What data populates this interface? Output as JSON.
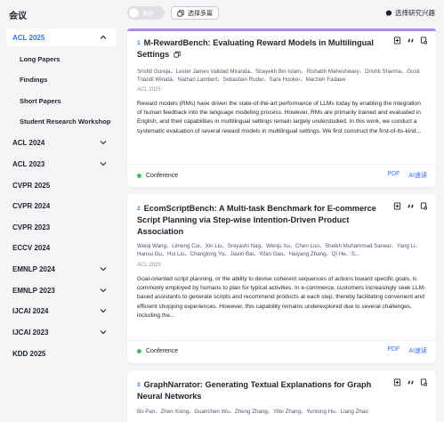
{
  "sidebar": {
    "title": "会议",
    "items": [
      {
        "label": "ACL 2025",
        "expanded": true
      },
      {
        "label": "ACL 2024"
      },
      {
        "label": "ACL 2023"
      },
      {
        "label": "CVPR 2025"
      },
      {
        "label": "CVPR 2024"
      },
      {
        "label": "CVPR 2023"
      },
      {
        "label": "ECCV 2024"
      },
      {
        "label": "EMNLP 2024"
      },
      {
        "label": "EMNLP 2023"
      },
      {
        "label": "IJCAI 2024"
      },
      {
        "label": "IJCAI 2023"
      },
      {
        "label": "KDD 2025"
      }
    ],
    "subitems": [
      "Long Papers",
      "Findings",
      "Short Papers",
      "Student Research Workshop"
    ]
  },
  "toolbar": {
    "toggle_label": "速读",
    "multi_select_label": "选择多篇",
    "interest_label": "选择研究兴趣"
  },
  "colors": {
    "accent": "#3370ff",
    "card_bar": "#a78bfa",
    "conference_dot": "#34c759"
  },
  "papers": [
    {
      "num": "1",
      "title": "M-RewardBench: Evaluating Reward Models in Multilingual Settings",
      "authors": "Srishti Gureja、Lester James Validad Miranda、Shayekh Bin Islam、Rishabh Maheshwary、Drishti Sharma、Gusti Triandi Winata、Nathan Lambert、Sebastian Ruder、Sara Hooker、Marzieh Fadaee",
      "venue": "ACL 2025",
      "abstract": "Reward models (RMs) have driven the state-of-the-art performance of LLMs today by enabling the integration of human feedback into the language modeling process. However, RMs are primarily trained and evaluated in English, and their capabilities in multilingual settings remain largely understudied. In this work, we conduct a systematic evaluation of several reward models in multilingual settings. We first construct the first-of-its-kind...",
      "type": "Conference",
      "pdf": "PDF",
      "ai": "AI速读"
    },
    {
      "num": "2",
      "title": "EcomScriptBench: A Multi-task Benchmark for E-commerce Script Planning via Step-wise Intention-Driven Product Association",
      "authors": "Weiqi Wang、Limeng Cui、Xin Liu、Sreyashi Nag、Wenju Xu、Chen Luo、Sheikh Muhammad Sarwar、Yang Li、Hansu Gu、Hui Liu、Changlong Yu、Jiaxin Bai、Yifan Gao、Haiyang Zhang、Qi He、S...",
      "venue": "ACL 2025",
      "abstract": "Goal-oriented script planning, or the ability to devise coherent sequences of actions toward specific goals, is commonly employed by humans to plan for typical activities. In e-commerce, customers increasingly seek LLM-based assistants to generate scripts and recommend products at each step, thereby facilitating convenient and efficient shopping experiences. However, this capability remains underexplored due to several challenges, including the...",
      "type": "Conference",
      "pdf": "PDF",
      "ai": "AI速读"
    },
    {
      "num": "3",
      "title": "GraphNarrator: Generating Textual Explanations for Graph Neural Networks",
      "authors": "Bo Pan、Zhen Xiong、Guanchen Wu、Zheng Zhang、Yifei Zhang、Yuntong Hu、Liang Zhao"
    }
  ]
}
